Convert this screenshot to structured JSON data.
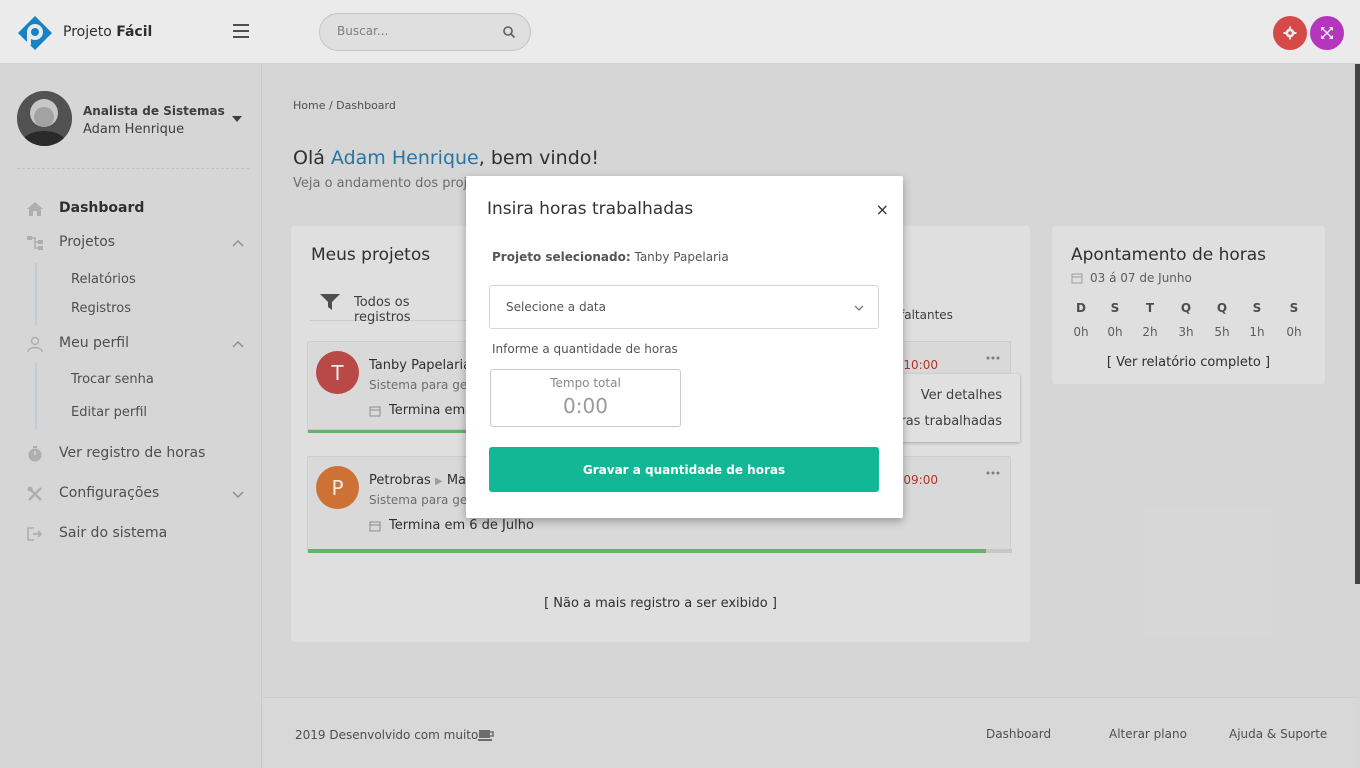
{
  "app": {
    "brand_prefix": "Projeto",
    "brand_bold": "Fácil"
  },
  "header": {
    "search_placeholder": "Buscar..."
  },
  "user": {
    "role": "Analista de Sistemas",
    "name": "Adam Henrique"
  },
  "sidebar": {
    "dashboard": "Dashboard",
    "projetos": "Projetos",
    "relatorios": "Relatórios",
    "registros": "Registros",
    "meu_perfil": "Meu perfil",
    "trocar_senha": "Trocar senha",
    "editar_perfil": "Editar perfil",
    "ver_registro": "Ver registro de horas",
    "configuracoes": "Configurações",
    "sair": "Sair do sistema"
  },
  "main": {
    "breadcrumb": "Home / Dashboard",
    "hello_prefix": "Olá ",
    "hello_name": "Adam Henrique",
    "hello_suffix": ", bem vindo!",
    "hello_sub": "Veja o andamento dos proj"
  },
  "projects": {
    "title": "Meus projetos",
    "filter": "Todos os registros",
    "faltantes": "faltantes",
    "items": [
      {
        "initial": "T",
        "name": "Tanby Papelaria",
        "desc": "Sistema para ges",
        "end": "Termina em 6",
        "time": "10:00",
        "progress": 0.0,
        "color": "#c9504e"
      },
      {
        "initial": "P",
        "name": "Petrobras",
        "name_extra": "Ma",
        "desc": "Sistema para ges",
        "end": "Termina em 6 de Julho",
        "time": "09:00",
        "progress": 0.96,
        "color": "#e07b39"
      }
    ],
    "menu": {
      "details": "Ver detalhes",
      "hours": "oras trabalhadas"
    },
    "no_more": "[ Não a mais registro a ser exibido ]"
  },
  "hours": {
    "title": "Apontamento de horas",
    "range": "03  á 07 de Junho",
    "days": [
      "D",
      "S",
      "T",
      "Q",
      "Q",
      "S",
      "S"
    ],
    "values": [
      "0h",
      "0h",
      "2h",
      "3h",
      "5h",
      "1h",
      "0h"
    ],
    "report": "[ Ver relatório completo ]"
  },
  "footer": {
    "copy": "2019 Desenvolvido com muito",
    "links": [
      "Dashboard",
      "Alterar plano",
      "Ajuda & Suporte"
    ]
  },
  "modal": {
    "title": "Insira horas trabalhadas",
    "close": "×",
    "project_label": "Projeto selecionado:",
    "project_value": " Tanby Papelaria",
    "date_placeholder": "Selecione a data",
    "qty_label": "Informe a quantidade de horas",
    "time_caption": "Tempo total",
    "time_placeholder": "0:00",
    "save": "Gravar a quantidade de horas"
  },
  "colors": {
    "accent": "#12b896",
    "link": "#2a7fb3",
    "gear": "#e8504f",
    "expand": "#c63ad0",
    "progress": "#74c270"
  }
}
